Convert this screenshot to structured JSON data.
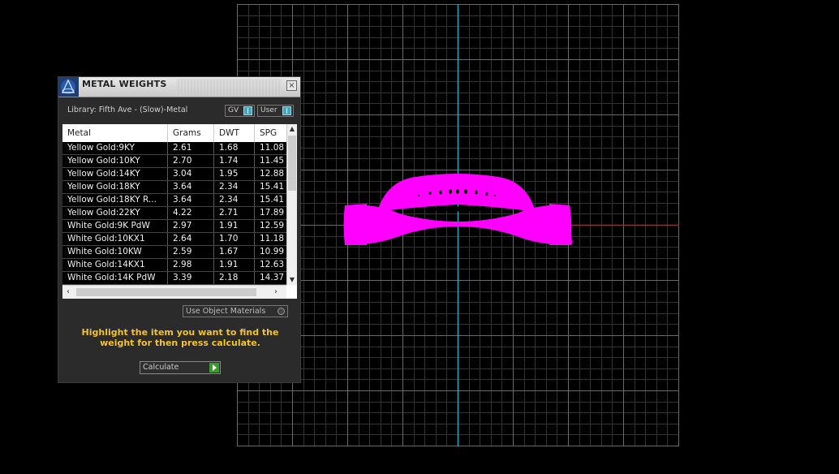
{
  "panel": {
    "title": "METAL WEIGHTS",
    "close_glyph": "×",
    "library_label": "Library: Fifth Ave - (Slow)-Metal",
    "toggle_gv": "GV",
    "toggle_user": "User",
    "use_object_materials": "Use Object Materials",
    "hint": "Highlight the item you want to find the weight for then press calculate.",
    "calculate_label": "Calculate"
  },
  "table": {
    "columns": [
      "Metal",
      "Grams",
      "DWT",
      "SPG"
    ],
    "rows": [
      [
        "Yellow Gold:9KY",
        "2.61",
        "1.68",
        "11.08"
      ],
      [
        "Yellow Gold:10KY",
        "2.70",
        "1.74",
        "11.45"
      ],
      [
        "Yellow Gold:14KY",
        "3.04",
        "1.95",
        "12.88"
      ],
      [
        "Yellow Gold:18KY",
        "3.64",
        "2.34",
        "15.41"
      ],
      [
        "Yellow Gold:18KY R...",
        "3.64",
        "2.34",
        "15.41"
      ],
      [
        "Yellow Gold:22KY",
        "4.22",
        "2.71",
        "17.89"
      ],
      [
        "White Gold:9K PdW",
        "2.97",
        "1.91",
        "12.59"
      ],
      [
        "White Gold:10KX1",
        "2.64",
        "1.70",
        "11.18"
      ],
      [
        "White Gold:10KW",
        "2.59",
        "1.67",
        "10.99"
      ],
      [
        "White Gold:14KX1",
        "2.98",
        "1.91",
        "12.63"
      ],
      [
        "White Gold:14K PdW",
        "3.39",
        "2.18",
        "14.37"
      ]
    ]
  },
  "icons": {
    "logo": "app-logo-icon",
    "close": "close-icon",
    "scroll_up": "chevron-up-icon",
    "scroll_down": "chevron-down-icon",
    "scroll_left": "chevron-left-icon",
    "scroll_right": "chevron-right-icon",
    "calculate": "play-icon"
  },
  "colors": {
    "ring": "#ff00ff",
    "axis_y": "#2aa7c0",
    "axis_x": "#c0201f",
    "hint_text": "#f2c230",
    "toggle": "#4aa3b8",
    "calculate_button": "#3a9b2e"
  }
}
